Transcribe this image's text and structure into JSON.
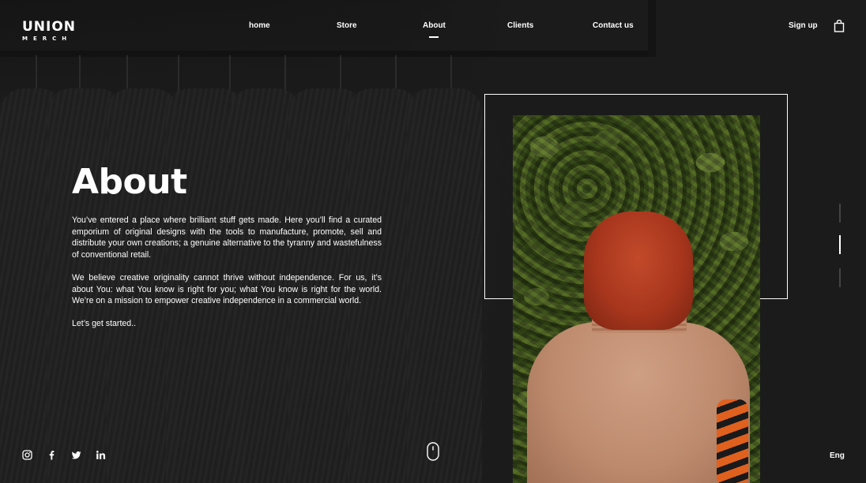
{
  "brand": {
    "name": "UNION",
    "sub": "MERCH"
  },
  "nav": {
    "items": [
      {
        "label": "home"
      },
      {
        "label": "Store"
      },
      {
        "label": "About"
      },
      {
        "label": "Clients"
      },
      {
        "label": "Contact us"
      }
    ],
    "active": "About"
  },
  "header": {
    "signup_label": "Sign up",
    "cart_icon": "shopping-bag-icon"
  },
  "main": {
    "title": "About",
    "paragraphs": [
      "You’ve entered a place where brilliant stuff gets made. Here you’ll find a curated emporium of original designs with the tools to manufacture, promote, sell and distribute your own creations; a genuine alternative to the tyranny and wastefulness of conventional retail.",
      "We believe creative originality cannot thrive without independence. For us, it’s about You: what You know is right for you; what You know is right for the world. We’re on a mission to empower creative independence in a commercial world.",
      "Let’s get started.."
    ]
  },
  "slider": {
    "count": 3,
    "active_index": 1
  },
  "footer": {
    "socials": [
      "instagram-icon",
      "facebook-icon",
      "twitter-icon",
      "linkedin-icon"
    ],
    "scroll_icon": "mouse-scroll-icon",
    "language": "Eng"
  },
  "colors": {
    "background": "#1b1b1b",
    "text": "#ffffff"
  }
}
